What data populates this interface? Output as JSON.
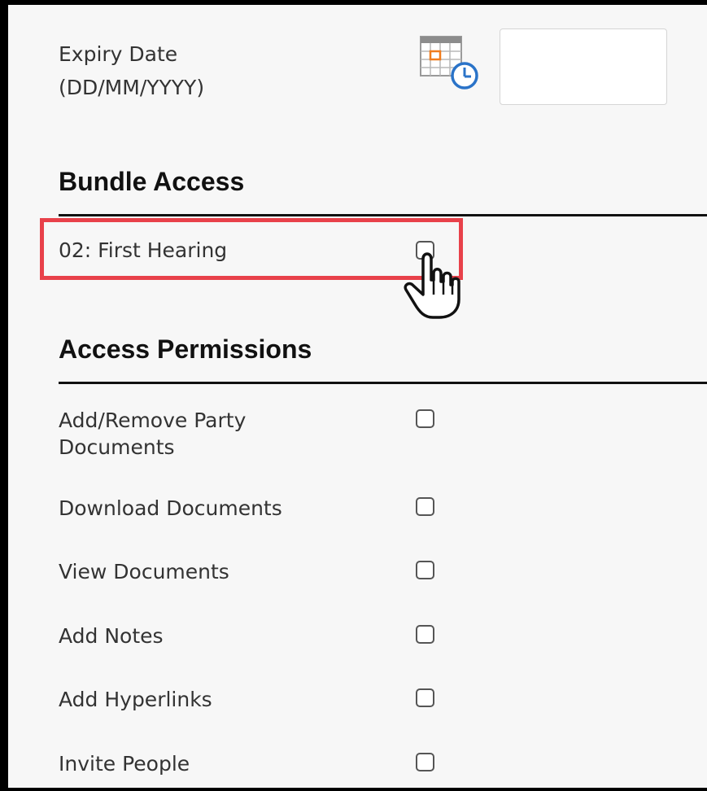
{
  "expiry": {
    "label_line1": "Expiry Date",
    "label_line2": "(DD/MM/YYYY)",
    "value": "",
    "icon": "calendar-clock-icon"
  },
  "bundle_access": {
    "title": "Bundle Access",
    "items": [
      {
        "label": "02: First Hearing",
        "checked": false
      }
    ]
  },
  "access_permissions": {
    "title": "Access Permissions",
    "items": [
      {
        "label_line1": "Add/Remove Party",
        "label_line2": "Documents",
        "checked": false
      },
      {
        "label": "Download Documents",
        "checked": false
      },
      {
        "label": "View Documents",
        "checked": false
      },
      {
        "label": "Add Notes",
        "checked": false
      },
      {
        "label": "Add Hyperlinks",
        "checked": false
      },
      {
        "label": "Invite People",
        "checked": false
      }
    ]
  },
  "colors": {
    "highlight": "#e8414a",
    "calendar_accent": "#f07c1e",
    "clock_accent": "#2a73c8"
  },
  "cursor": "hand-pointer-icon"
}
